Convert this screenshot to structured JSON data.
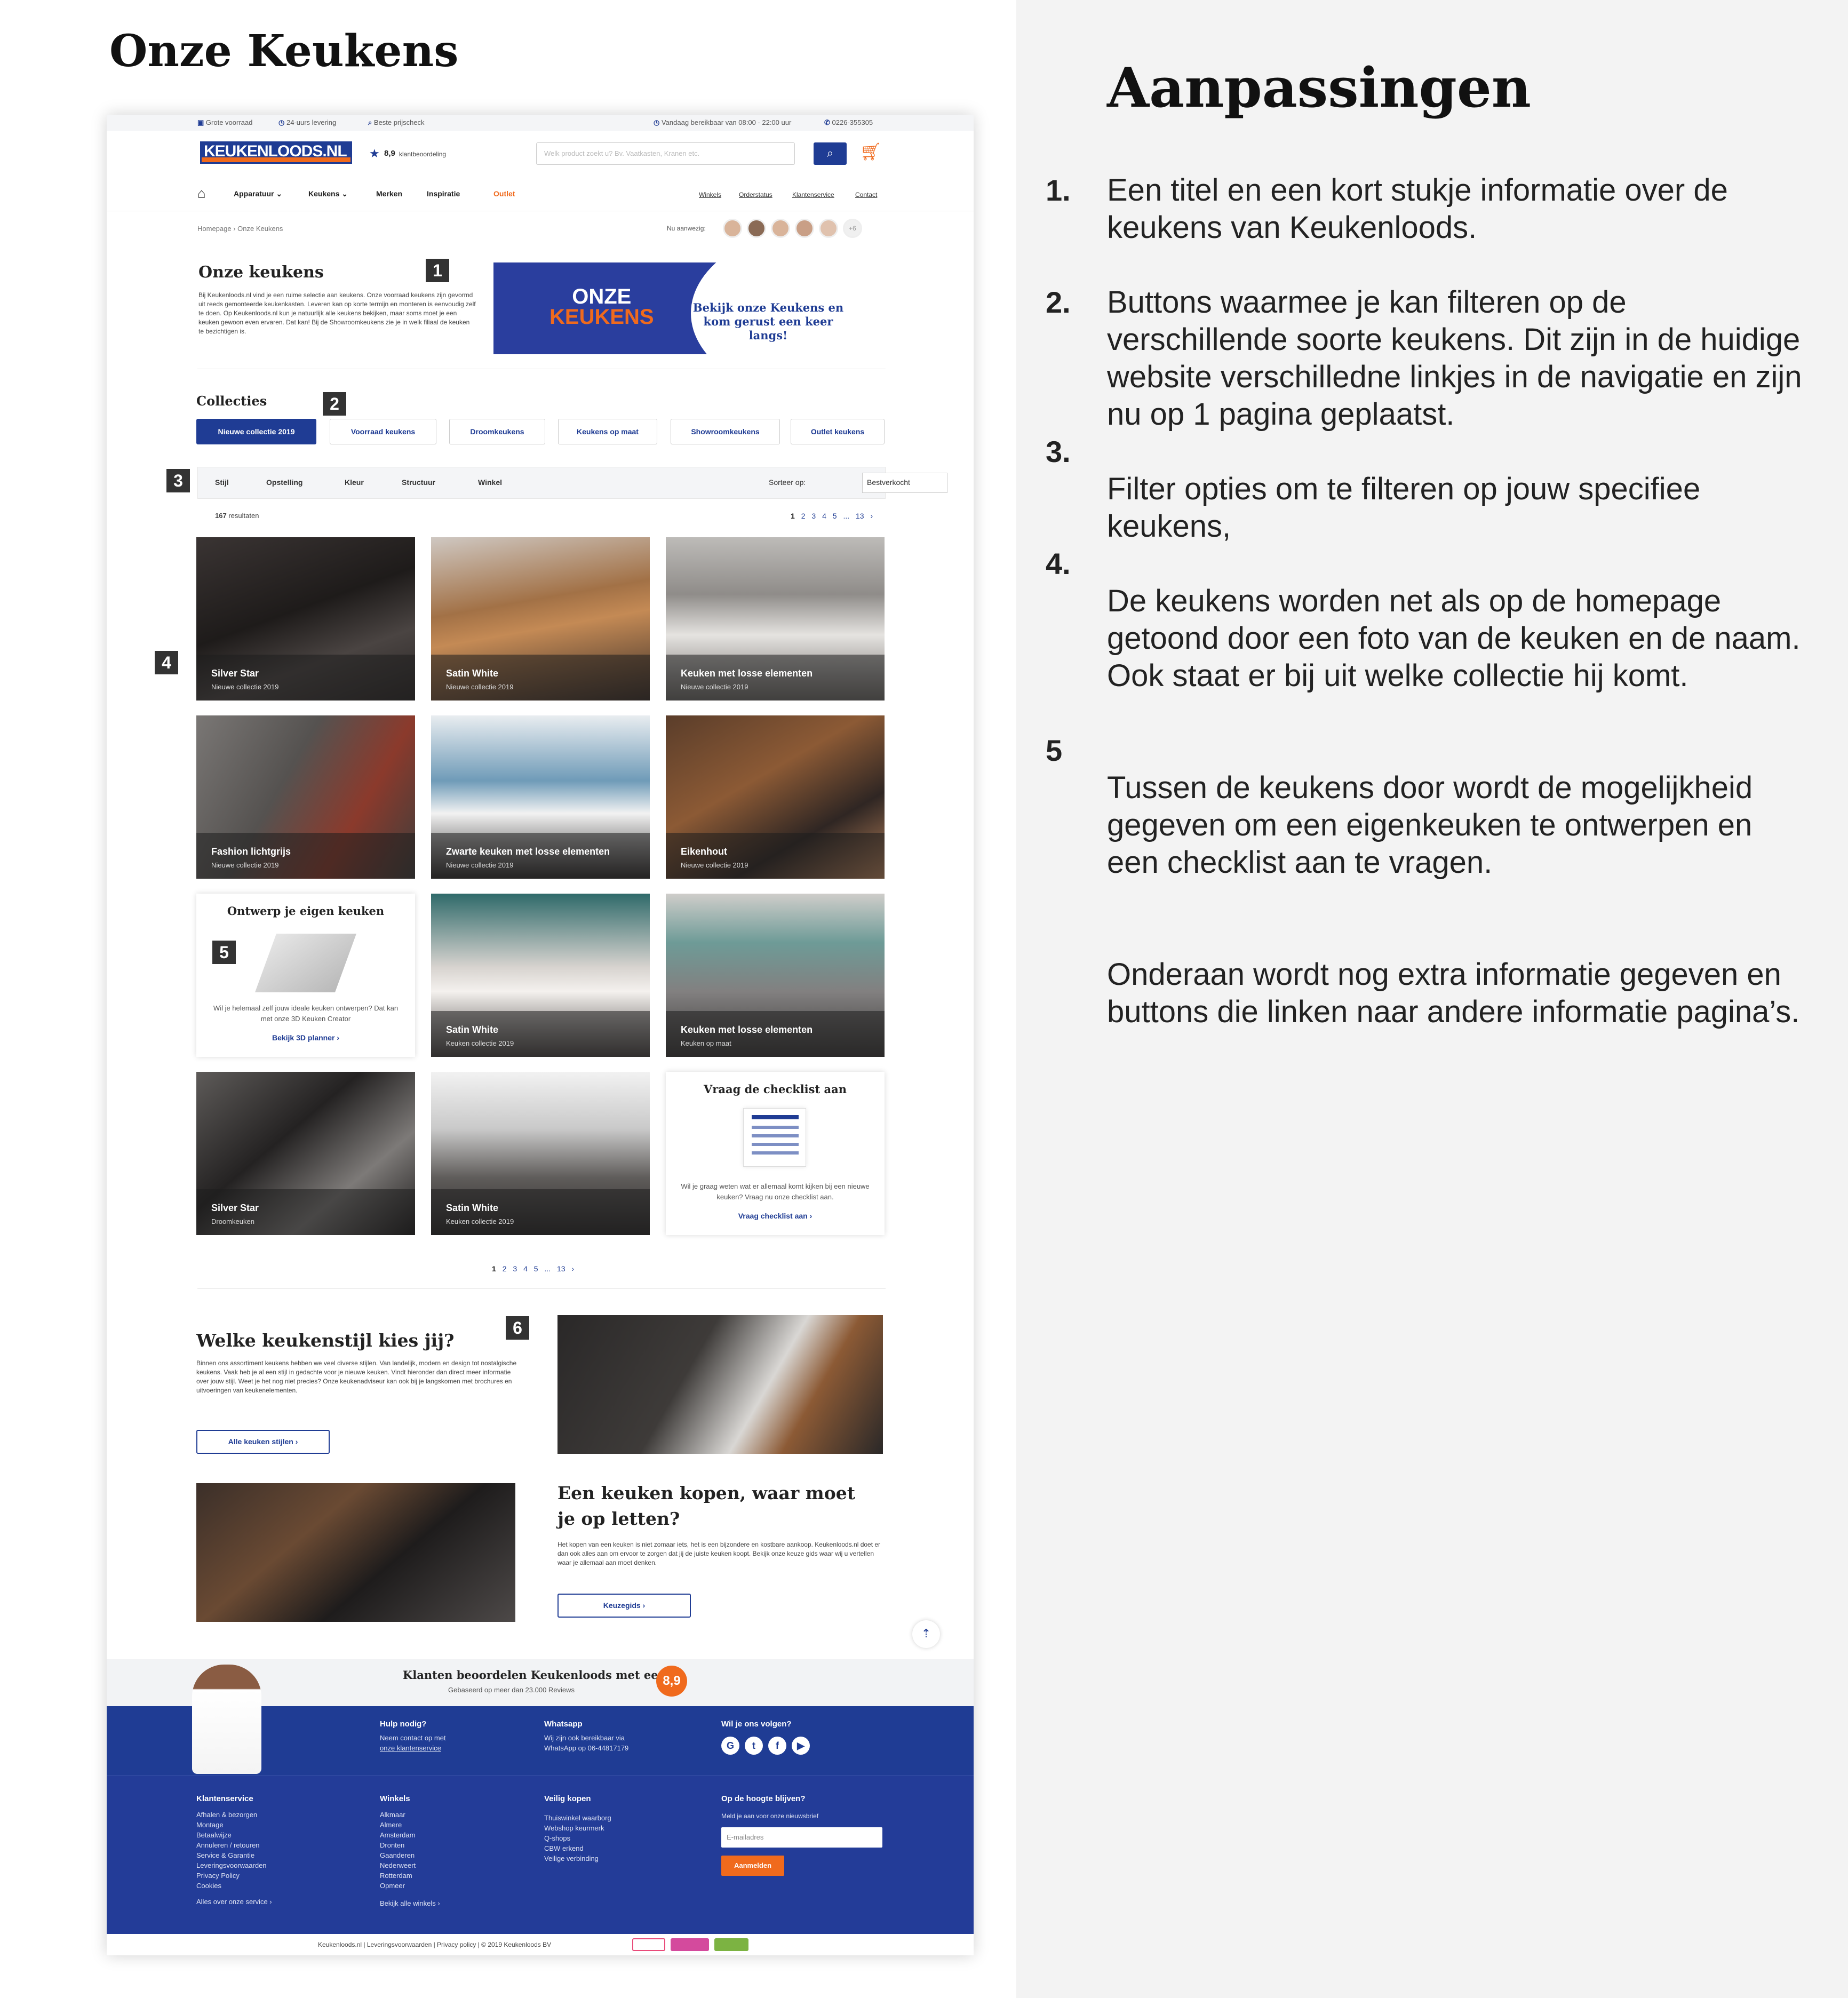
{
  "page_title": "Onze Keukens",
  "right_title": "Aanpassingen",
  "notes": [
    {
      "num": "1.",
      "text": "Een titel en een kort stukje informatie over de keukens van Keukenloods."
    },
    {
      "num": "2.",
      "text": "Buttons waarmee je kan filteren op de verschillende soorte keukens. Dit zijn in de huidige website verschilledne linkjes in de navigatie en zijn nu op 1 pagina geplaatst."
    },
    {
      "num": "3.",
      "text": "Filter opties om te filteren op jouw specifiee keukens,"
    },
    {
      "num": "4.",
      "text": "De keukens worden net als op de homepage getoond door een foto van de keuken en de naam. Ook staat er bij uit welke collectie hij komt."
    },
    {
      "num": "5",
      "text": "Tussen de keukens door wordt de mogelijkheid gegeven om een eigenkeuken te ontwerpen en een checklist aan te vragen."
    },
    {
      "num": "",
      "text": "Onderaan wordt nog extra informatie gegeven en buttons die linken naar andere informatie pagina’s."
    }
  ],
  "mock": {
    "topbar": {
      "stock": "Grote voorraad",
      "delivery": "24-uurs levering",
      "price": "Beste prijscheck",
      "hours": "Vandaag bereikbaar van 08:00 - 22:00 uur",
      "phone": "0226-355305"
    },
    "logo": "KEUKENLOODS.NL",
    "rating": "8,9",
    "rating_label": "klantbeoordeling",
    "search_placeholder": "Welk product zoekt u? Bv. Vaatkasten, Kranen etc.",
    "nav": [
      "Apparatuur",
      "Keukens",
      "Merken",
      "Inspiratie",
      "Outlet"
    ],
    "nav_right": [
      "Winkels",
      "Orderstatus",
      "Klantenservice",
      "Contact"
    ],
    "breadcrumb": "Homepage › Onze Keukens",
    "present_label": "Nu aanwezig:",
    "present_more": "+6",
    "intro": {
      "title": "Onze keukens",
      "text": "Bij Keukenloods.nl vind je een ruime selectie aan keukens. Onze voorraad keukens zijn gevormd uit reeds gemonteerde keukenkasten. Leveren kan op korte termijn en monteren is eenvoudig zelf te doen. Op Keukenloods.nl kun je natuurlijk alle keukens bekijken, maar soms moet je een keuken gewoon even ervaren. Dat kan! Bij de Showroomkeukens zie je in welk filiaal de keuken te bezichtigen is."
    },
    "banner": {
      "line1": "ONZE",
      "line2": "KEUKENS",
      "side": "Bekijk onze Keukens en kom gerust een keer langs!"
    },
    "markers": [
      "1",
      "2",
      "3",
      "4",
      "5",
      "6"
    ],
    "collections_title": "Collecties",
    "collections": [
      "Nieuwe collectie 2019",
      "Voorraad keukens",
      "Droomkeukens",
      "Keukens op maat",
      "Showroomkeukens",
      "Outlet keukens"
    ],
    "filters": [
      "Stijl",
      "Opstelling",
      "Kleur",
      "Structuur",
      "Winkel"
    ],
    "sort_label": "Sorteer op:",
    "sort_value": "Bestverkocht",
    "results_count": "167",
    "results_label": "resultaten",
    "pages": [
      "1",
      "2",
      "3",
      "4",
      "5",
      "...",
      "13",
      "›"
    ],
    "cards": [
      {
        "name": "Silver Star",
        "sub": "Nieuwe collectie 2019"
      },
      {
        "name": "Satin White",
        "sub": "Nieuwe collectie 2019"
      },
      {
        "name": "Keuken met losse elementen",
        "sub": "Nieuwe collectie 2019"
      },
      {
        "name": "Fashion lichtgrijs",
        "sub": "Nieuwe collectie 2019"
      },
      {
        "name": "Zwarte keuken met losse elementen",
        "sub": "Nieuwe collectie 2019"
      },
      {
        "name": "Eikenhout",
        "sub": "Nieuwe collectie 2019"
      },
      {
        "name": "Satin White",
        "sub": "Keuken collectie 2019"
      },
      {
        "name": "Keuken met losse elementen",
        "sub": "Keuken op maat"
      },
      {
        "name": "Silver Star",
        "sub": "Droomkeuken"
      },
      {
        "name": "Satin White",
        "sub": "Keuken collectie 2019"
      }
    ],
    "design_card": {
      "title": "Ontwerp je eigen keuken",
      "text": "Wil je helemaal zelf jouw ideale keuken ontwerpen? Dat kan met onze 3D Keuken Creator",
      "link": "Bekijk 3D planner ›"
    },
    "checklist_card": {
      "title": "Vraag de checklist aan",
      "text": "Wil je graag weten wat er allemaal komt kijken bij een nieuwe keuken? Vraag nu onze checklist aan.",
      "link": "Vraag checklist aan ›"
    },
    "style_section": {
      "title": "Welke keukenstijl kies jij?",
      "text": "Binnen ons assortiment keukens hebben we veel diverse stijlen. Van landelijk, modern en design tot nostalgische keukens. Vaak heb je al een stijl in gedachte voor je nieuwe keuken. Vindt hieronder dan direct meer informatie over jouw stijl. Weet je het nog niet precies? Onze keukenadviseur kan ook bij je langskomen met brochures en uitvoeringen van keukenelementen.",
      "button": "Alle keuken stijlen ›"
    },
    "buy_section": {
      "title_1": "Een keuken kopen, waar moet",
      "title_2": "je op letten?",
      "text": "Het kopen van een keuken is niet zomaar iets, het is een bijzondere en kostbare aankoop. Keukenloods.nl doet er dan ook alles aan om ervoor te zorgen dat jij de juiste keuken koopt. Bekijk onze keuze gids waar wij u vertellen waar je allemaal aan moet denken.",
      "button": "Keuzegids ›"
    },
    "reviews": {
      "title": "Klanten beoordelen Keukenloods met een",
      "sub": "Gebaseerd op meer dan 23.000 Reviews",
      "score": "8,9"
    },
    "footer_top": [
      {
        "title": "Hulp nodig?",
        "lines": [
          "Neem contact op met",
          "onze klantenservice"
        ]
      },
      {
        "title": "Whatsapp",
        "lines": [
          "Wij zijn ook bereikbaar via",
          "WhatsApp op 06-44817179"
        ]
      },
      {
        "title": "Wil je ons volgen?",
        "lines": []
      }
    ],
    "social": [
      "G",
      "t",
      "f",
      "▶"
    ],
    "footer_cols": [
      {
        "title": "Klantenservice",
        "links": [
          "Afhalen & bezorgen",
          "Montage",
          "Betaalwijze",
          "Annuleren / retouren",
          "Service & Garantie",
          "Leveringsvoorwaarden",
          "Privacy Policy",
          "Cookies"
        ],
        "more": "Alles over onze service ›"
      },
      {
        "title": "Winkels",
        "links": [
          "Alkmaar",
          "Almere",
          "Amsterdam",
          "Dronten",
          "Gaanderen",
          "Nederweert",
          "Rotterdam",
          "Opmeer"
        ],
        "more": "Bekijk alle winkels ›"
      },
      {
        "title": "Veilig kopen",
        "links": [
          "Thuiswinkel waarborg",
          "Webshop keurmerk",
          "Q-shops",
          "CBW erkend",
          "Veilige verbinding"
        ],
        "more": ""
      }
    ],
    "newsletter": {
      "title": "Op de hoogte blijven?",
      "sub": "Meld je aan voor onze nieuwsbrief",
      "placeholder": "E-mailadres",
      "button": "Aanmelden"
    },
    "copyright": "Keukenloods.nl | Leveringsvoorwaarden | Privacy policy | © 2019 Keukenloods BV"
  },
  "colors": {
    "brand_blue": "#1f3c94",
    "brand_orange": "#f06a1d"
  }
}
